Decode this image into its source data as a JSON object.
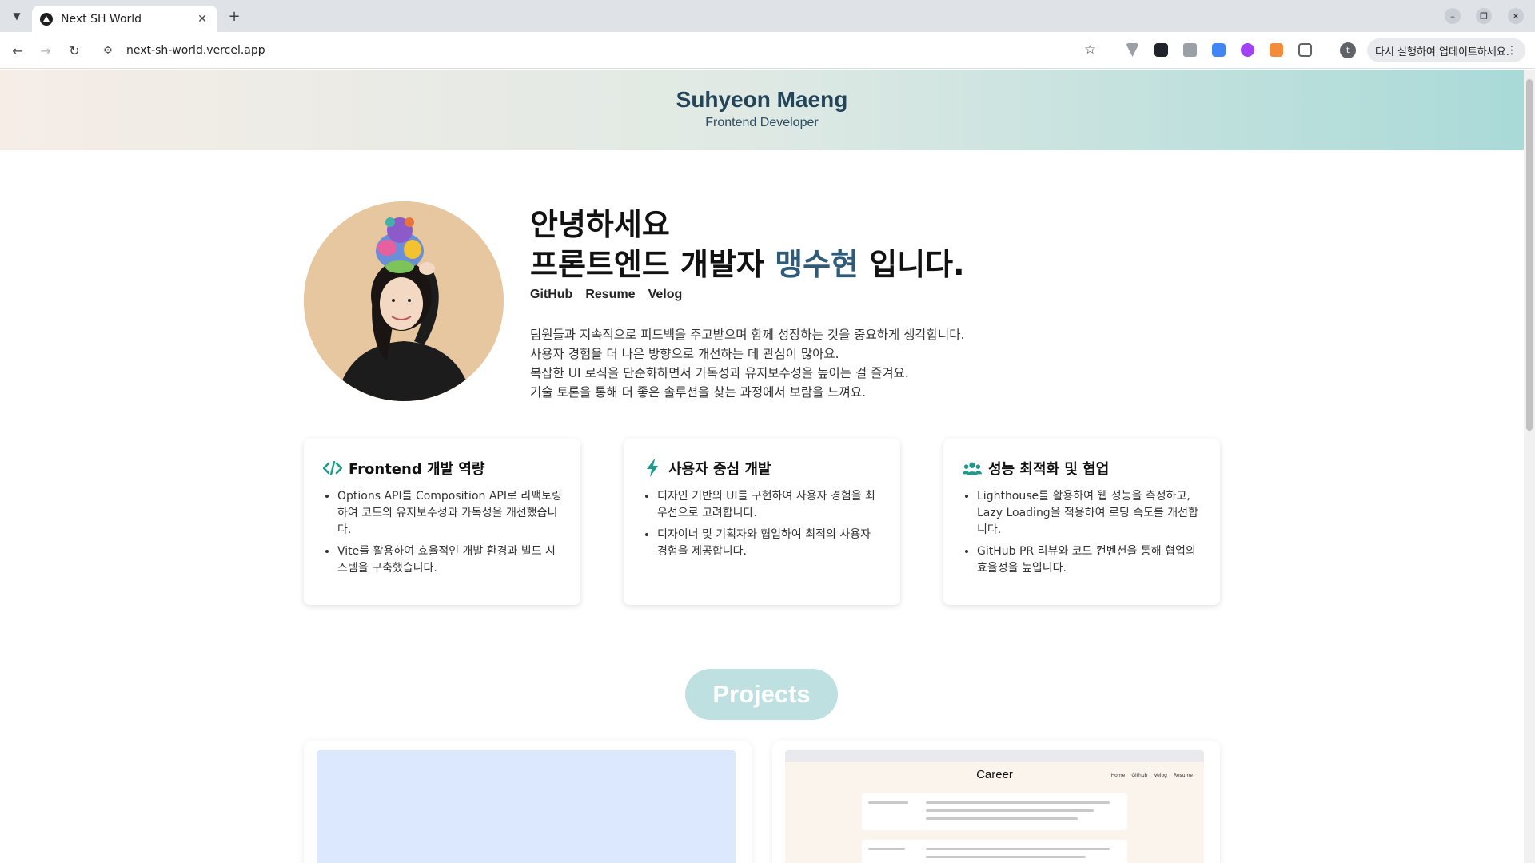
{
  "browser": {
    "tab_title": "Next SH World",
    "url": "next-sh-world.vercel.app",
    "update_label": "다시 실행하여 업데이트하세요.",
    "profile_initial": "t"
  },
  "header": {
    "name": "Suhyeon Maeng",
    "role": "Frontend Developer"
  },
  "intro": {
    "greeting_line1": "안녕하세요",
    "greeting_prefix": "프론트엔드 개발자 ",
    "greeting_name": "맹수현",
    "greeting_suffix": " 입니다.",
    "links": [
      "GitHub",
      "Resume",
      "Velog"
    ],
    "bio": [
      "팀원들과 지속적으로 피드백을 주고받으며 함께 성장하는 것을 중요하게 생각합니다.",
      "사용자 경험을 더 나은 방향으로 개선하는 데 관심이 많아요.",
      "복잡한 UI 로직을 단순화하면서 가독성과 유지보수성을 높이는 걸 즐겨요.",
      "기술 토론을 통해 더 좋은 솔루션을 찾는 과정에서 보람을 느껴요."
    ]
  },
  "cards": [
    {
      "icon": "code-icon",
      "title": "Frontend 개발 역량",
      "items": [
        "Options API를 Composition API로 리팩토링하여 코드의 유지보수성과 가독성을 개선했습니다.",
        "Vite를 활용하여 효율적인 개발 환경과 빌드 시스템을 구축했습니다."
      ]
    },
    {
      "icon": "bolt-icon",
      "title": "사용자 중심 개발",
      "items": [
        "디자인 기반의 UI를 구현하여 사용자 경험을 최우선으로 고려합니다.",
        "디자이너 및 기획자와 협업하여 최적의 사용자 경험을 제공합니다."
      ]
    },
    {
      "icon": "users-icon",
      "title": "성능 최적화 및 협업",
      "items": [
        "Lighthouse를 활용하여 웹 성능을 측정하고, Lazy Loading을 적용하여 로딩 속도를 개선합니다.",
        "GitHub PR 리뷰와 코드 컨벤션을 통해 협업의 효율성을 높입니다."
      ]
    }
  ],
  "projects": {
    "section_title": "Projects",
    "thumb_title": "Career",
    "thumb_nav": [
      "Home",
      "Github",
      "Velog",
      "Resume"
    ]
  },
  "colors": {
    "accent": "#2f5b78",
    "icon_teal": "#1f9a8a",
    "projects_pill": "#bee0e0"
  }
}
